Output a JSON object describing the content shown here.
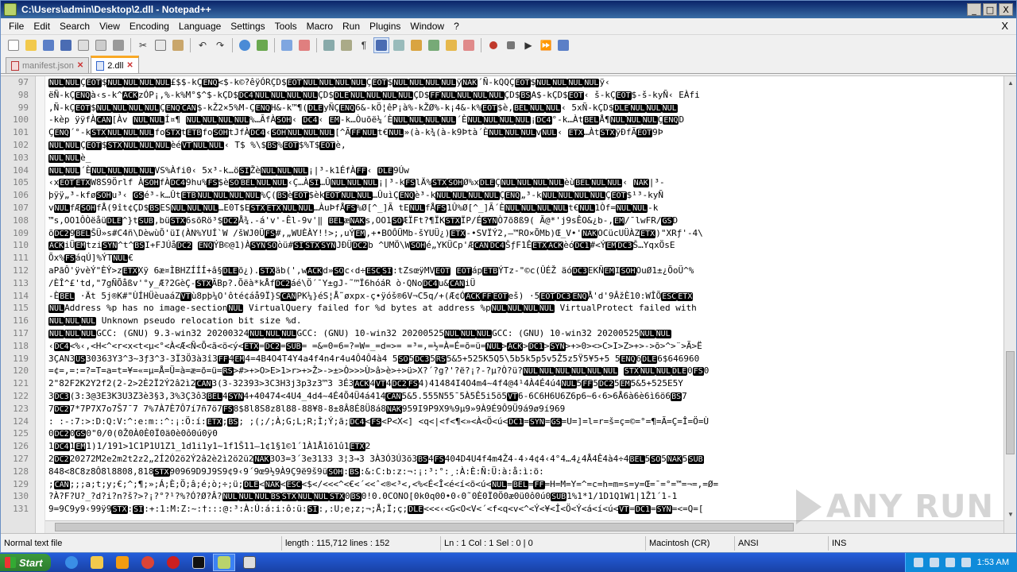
{
  "window": {
    "title": "C:\\Users\\admin\\Desktop\\2.dll - Notepad++",
    "min": "_",
    "max": "□",
    "close": "X"
  },
  "menu": [
    "File",
    "Edit",
    "Search",
    "View",
    "Encoding",
    "Language",
    "Settings",
    "Tools",
    "Macro",
    "Run",
    "Plugins",
    "Window",
    "?"
  ],
  "menu_close": "X",
  "tabs": [
    {
      "label": "manifest.json",
      "active": false
    },
    {
      "label": "2.dll",
      "active": true
    }
  ],
  "editor": {
    "line_numbers": [
      "97",
      "98",
      "99",
      "100",
      "101",
      "102",
      "103",
      "104",
      "105",
      "106",
      "107",
      "108",
      "109",
      "110",
      "111",
      "112",
      "113",
      "114",
      "115",
      "116",
      "117",
      "118",
      "119",
      "120",
      "121",
      "122",
      "123",
      "124",
      "125",
      "126",
      "127",
      "128",
      "129",
      "130",
      "131"
    ],
    "lines": [
      "NULNULÇEOT$NULNULNULNUL£$$-kÇENQ<$-k©?êÿÓRÇD$EOTNULNULNULNULÇEOT$NULNULNULNULÿNAK´Ñ-kQQÇEOT$NULNULNULNULÿ‹",
      "ëÑ-kÇENQà‹s-k^ACKzÓP¡,%-k%M°$^$-kÇD$DC4NULNULNULNULÇD$DLENULNULNULNULÇD$FFNULNULNULNULÇD$BSA$-kÇD$EOT‹ š-kÇEOT$-š-kyÑ‹ EÀfi",
      ",Ñ-kÇEOT$NULNULNULNULÇENQCAN$-kŽ2×5%M-ÇENQH&-k™¶(DLEyÑÇENQ6&-kÖ¦êP¡à%-kŽØ%-k¡4&-k%EOT$è,BELNULNUL‹ 5xÑ-kÇD$DLENULNULNUL",
      "-kèp    ÿÿfÀCAN[Àv NULNULÍ¤¶ NULNULNULNUL%…ÃfÀSOH‹ DC4‹ EM-k…Òuõë¼´ÈNULNULNULNUL´ÈNULNULNULNUL¡DC4°-k…ÀtBELÅ¶NULNULNULÇENQD",
      "ÇENQ´°-kSTXNULNULNULfoSTXtETBfoSOHtJfÀDC4‹SOHNULNULNUL[^ÃFFNULt€NUL»(à-k¾(à-k9Þtà´ÈNULNULNULvNUL‹ ETX…ÀtSTXÿÐfÃEOT9Þ",
      "NULNULÇEOT$STXNULNULNULèéVTNULNUL‹ T$ %\\$BS%EOT$%T$EOTè,",
      "NULNULè_",
      "NULNUL´ÈNULNULNULNULVS%Àfi0‹ 5x³-k…öSIŽèNULNULNUL¡|³-k1ÉfÀFF‹ DLE9Úw",
      "‹xEOTETXW8S9Örlf ÀSOHfÀDC49hu%FS$èSOBELNULNUL‹Ç…ÀSI…ÛNULNULNUL¡|³-kFSlÄ%STXSOHØ%xDLEÇNULNULNULNULèùBELNULNUL‹ NAK|³-",
      "þÿÿ„³-kføSOHu³‹ GSé³-k…ÛtETBNULNULNULNUL%Ç(BSèEOT$èkEOTNULNUL…ÛuìÇENQè³-kNULNULNULNULÇENQ„³-kNULNULNULNULÇEOT$¹³-kyÑ",
      "vNULfÆSOHfÅ(9ît¢ÇD$BSESNULNULNUL…E0T$ESTXETXNULNUL…ÀuÞfÅFS%Ø[^_]Ã tENULfÅFS1Û%Ø[^_]Ã´ÈNULNULNULNULt€NUL1Òf=NULNUL-k",
      "™s‚OO1ÔÒëåüDLE^}tSUB‚büSTX6sõRö³$DC2Å¾.-á'v'-Êl-9v'‖     BELæNAKs‚OO1SOÆÏFt?¶ÏKSTXÏP/ÉSYNÒ7õ8ß9(      Ã@*'j9sÊO&¿b-‚EM/¯lwFR/GSD",
      "õDC29BELŠÜ»s#C4ñ\\DèwùÕ'üI(ÀN%YUÍ`W /šWJ0ÜFS#‚„WUÈÀY!!>;‚uÝEM‚+•BOÔÜMb-šYUÜ¿)ETX-•SVÏÝ2,—™RO×ÕMb)Œ_V•'NAKOCücUÜÀZETX)\"XRƒ'-4\\",
      "ACKiÜEMtziSYN^t^BSI+FJÚåDC2  ENQÝB©@1)ÀSYNSOòü#SISTXSYNJÐÜDC2b ^UMÖ\\WSOHé„YKÜCp'ÆCANDC4ŠƒF1ÊETXACKèóDC1#<ÝEMDC3Š…YqxÖsE",
      "Õx%FSáqÚ]%ÝTNUL€",
      "aPãÔ'ÿvèÝ\"ÈÝ>zETXXÿ 6æ¤ÌBHZÍÍÍ+â§DLEõ¿).STXäb(',wACKd»SOc‹d÷ESCSI:tZsœÿMVEOT EOTápETBÝTz-\"©c(ÛÉŽ äóDC3EKÑEMISOHOuØ1±¿ÕoÜ^%",
      "/ÈÎ^£'td,\"7gÑÕåßv'°y_Æ?2GèÇ-STXÃBp?.Õëà*kÅfDC2áé\\Ö´¯Y±gJ-˜™Ï6hóáR ò·QNoDC4u&CANiÜ",
      "-ÈBEL ·Ät 5j®K#\"ÙÍHÜèuaáZVTù8pþ¼O'ôté¢áå9Ï}SCANPK¼}éS¦Å˜øxpx-ç•ÿóš®6V¬C5q/+(Æ¢ÓACKFFEOTeš) ·5EOTDC3ENQÅ'd'9ÂžÈ10:WÎÕESCETX",
      "NULAddress %p has no image-sectionNUL  VirtualQuery failed for %d bytes at address %pNULNULNULNUL  VirtualProtect failed with",
      "NULNULNUL  Unknown pseudo relocation bit size %d.",
      "NULNULNULGCC: (GNU) 9.3-win32 20200324NULNULNULGCC: (GNU) 10-win32 20200525NULNULNULGCC: (GNU) 10-win32 20200525NULNUL",
      "‹DC4<%‹,<H<^<r<x<t<µ<°<À<Æ<Ñ<Õ<ã<ö<ý<ETX=DC2=SUB= =&=0=6=?=W=_=d=>= =³=‚=½=À=É=õ=ü=NUL>ACK>DC1>SYN>+>0><>C>I>Z>+>->õ>^>¨>Ã>Ë",
      "3ÇAN3US30363Y3^3~3ƒ3^3-3Ï3Ö3à3î3FF4EM4=4B4O4T4Y4a4f4n4r4u4Ô4Ô4à4    5SO5DC35RS5&5+525K5Q5\\5b5k5p5v5Ž5z5Ÿ5¥5+5 5ENQ6DLE6$646960",
      "=¢=,=:=?=T=a=t=¥=«=µ=Å=Ü=à=æ=õ=ü=RS>#>+>O>E>1>r>+>Ž>->±>Ò>>>Ù>â>è>÷>ü>X?´?g?'?ë?¡?-?µ?Ò?ü?NULNULNULNULNULNUL STXNULNULDLE0FS0",
      "2\"82F2K2Y2f2(2-2>2È2Ï2Ý2â2ì2CAN3(3-32393>3C3H3j3p3z3™3 3É3ACK4VT4DC2FS4)41484I4O4m4~4f4@4¹4À4É4ú4NUL5FF5DC25EM5&5+525E5Y",
      "3DC3(3:3@3E3K3U3Z3è3§3‚3%3Ç3ô3BEL4SYN4+40474<4U4_4d4~4É4Õ4Ü4á414CAN5&5.555N55¯5À5Ê5i5õ5VT6-6C6H6U6Z6p6~6‹6>6Å6à6è6ì6ö6BS7",
      "7DC27*7P7X7o7Š7¯7 7%7À7È7Ô7í7ñ7ö7FS8$8l8S8z8l88-88¥8-8±8Â8É8Ü8á8NAK959I9P9X9%9µ9»9À9É9Ô9Ü9á9ø9í969",
      ": :-:7:>:D:Q:V:^:e:m::^:¡:Ö:í:ETX;BS; ;(;/;À;G;L;R;Ì;Ý;ã;DC4<FS<P<X<] <q<|<f<¶<»<À<Ö<ú<DC1=SYN=GS=U=]=l=r=š=ç=©=°=¶=Ã=Ç=Î=Ö=Ù",
      "0DC20GS0\"0/0(0Ž0À0È0Ï0ä0è0ô0ú0ÿ0",
      "1DC41EM1)1/191>1C1P1U1Z1_1d1i1y1~1f1Š11—1¢1§1©1´1À1Å1õ1û1ETX2",
      "2DC220272M2e2m2t2z2„2Í2Ó2ö2Ý2â2è2ì2ö2ü2NAK3O3=3´3e3133 3¦3→3 3À3Ó3Ú3õ3BS4FS404D4U4f4m4Ž4-4›4¢4‹4°4…4¿4Å4Ê4à4÷4BEL5SO5NAK5SUB",
      "848<8C8z8Ô8l8808‚818STX90969D9J9S9¢9‹9´9œ9½9À9Ç9ë9š9üSOH:BS:&:C:b:z:¬:¡:³:°:¸:À:È:Ñ:Ü:à:å:ì:ö:",
      ";CAN;;;a;t;y;€;^;¶;»;Á;È;Ö;â;é;ò;÷;ü;DLE<NAK<ESC<$</<<<^<€<´<<ˆ<®<³<‚<%<É<Î<é<í<õ<ú<NUL=BEL=FF=H=M=Y=^=c=h=m=s=y=Œ=¯=°=™=¬=‚=Ø=",
      "?À?F?U?_?d?i?n?š?>?¡?°?¹?%?Ó?Ø?Â?NULNULNULBSSTXNULNULSTX0BS0!0.0CONO[0k0q00•0‹0˜0È0Ï0Ö0æ0ü0ô0ú0SUB1%1*1/1D1Q1W1|1Ž1´1-1",
      "9=9C9y9‹99ÿ9STX:SI:+:1:M:Z:~:†:::@:³:À:Ú:á:i:ô:ü:SI:,:U;e;z;¬;Å;Ï;ç;DLE<<<‹<G<O<V<´<f<q<v<^<Ý<¥<Î<Ö<Ý<á<í<ú<VT=DC1=SYN=<=Q=["
    ]
  },
  "control_tokens": [
    "NUL",
    "EOT",
    "ENQ",
    "ACK",
    "BEL",
    "BS",
    "VT",
    "FF",
    "SO",
    "SI",
    "DLE",
    "DC1",
    "DC2",
    "DC3",
    "DC4",
    "NAK",
    "SYN",
    "ETB",
    "CAN",
    "EM",
    "SUB",
    "ESC",
    "FS",
    "GS",
    "RS",
    "US",
    "STX",
    "ETX",
    "SOH"
  ],
  "status": {
    "type": "Normal text file",
    "length": "length : 115,712    lines : 152",
    "position": "Ln : 1    Col : 1    Sel : 0 | 0",
    "eol": "Macintosh (CR)",
    "encoding": "ANSI",
    "mode": "INS"
  },
  "watermark": "ANY RUN",
  "taskbar": {
    "start": "Start",
    "clock": "1:53 AM"
  }
}
